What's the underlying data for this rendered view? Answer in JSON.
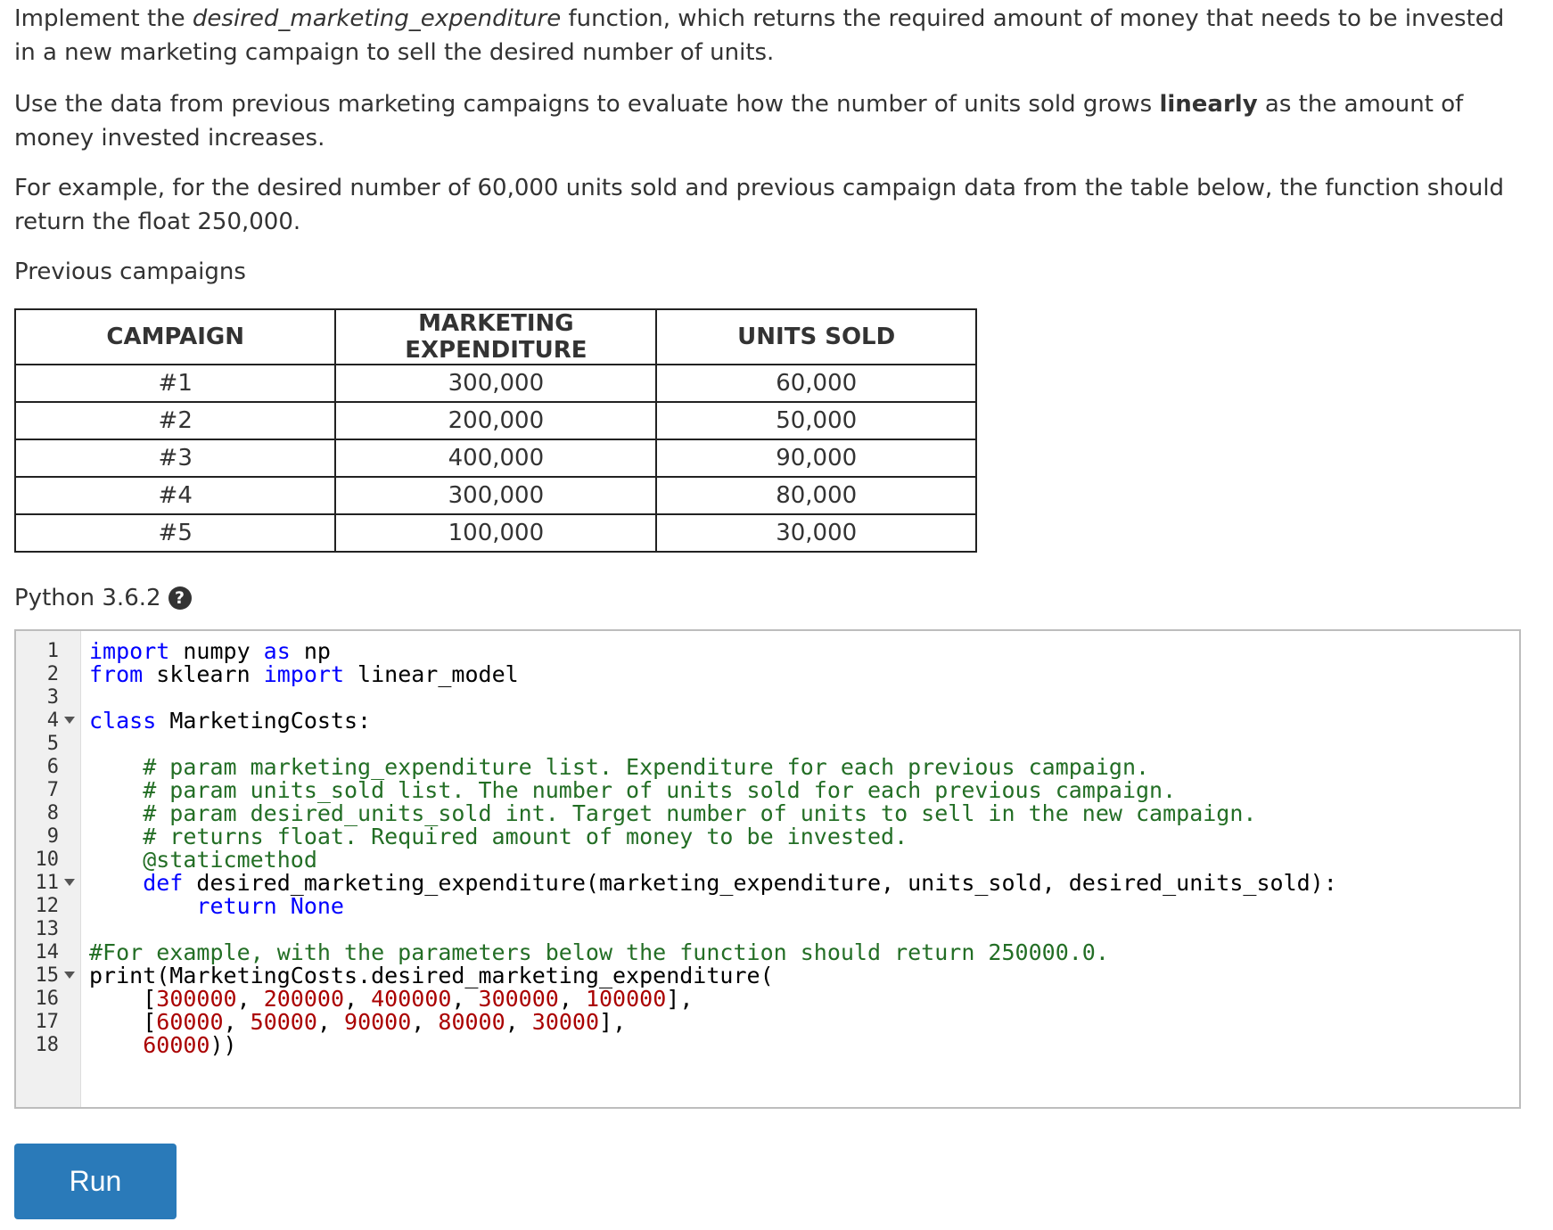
{
  "description": {
    "p1": {
      "before": "Implement the ",
      "func_name": "desired_marketing_expenditure",
      "after": " function, which returns the required amount of money that needs to be invested in a new marketing campaign to sell the desired number of units."
    },
    "p2": {
      "before": "Use the data from previous marketing campaigns to evaluate how the number of units sold grows ",
      "bold": "linearly",
      "after": " as the amount of money invested increases."
    },
    "p3": "For example, for the desired number of 60,000 units sold and previous campaign data from the table below, the function should return the float 250,000.",
    "p4": "Previous campaigns"
  },
  "table": {
    "headers": [
      "CAMPAIGN",
      "MARKETING EXPENDITURE",
      "UNITS SOLD"
    ],
    "rows": [
      [
        "#1",
        "300,000",
        "60,000"
      ],
      [
        "#2",
        "200,000",
        "50,000"
      ],
      [
        "#3",
        "400,000",
        "90,000"
      ],
      [
        "#4",
        "300,000",
        "80,000"
      ],
      [
        "#5",
        "100,000",
        "30,000"
      ]
    ]
  },
  "editor": {
    "language_label": "Python 3.6.2",
    "help_icon": "question-circle-icon",
    "line_numbers": [
      "1",
      "2",
      "3",
      "4",
      "5",
      "6",
      "7",
      "8",
      "9",
      "10",
      "11",
      "12",
      "13",
      "14",
      "15",
      "16",
      "17",
      "18"
    ],
    "fold_lines": [
      "4",
      "11",
      "15"
    ],
    "code": {
      "l1_kw1": "import",
      "l1_mid": " numpy ",
      "l1_kw2": "as",
      "l1_end": " np",
      "l2_kw1": "from",
      "l2_mid": " sklearn ",
      "l2_kw2": "import",
      "l2_end": " linear_model",
      "l4_kw": "class",
      "l4_end": " MarketingCosts:",
      "l6": "    # param marketing_expenditure list. Expenditure for each previous campaign.",
      "l7": "    # param units_sold list. The number of units sold for each previous campaign.",
      "l8": "    # param desired_units_sold int. Target number of units to sell in the new campaign.",
      "l9": "    # returns float. Required amount of money to be invested.",
      "l10": "    @staticmethod",
      "l11_kw": "    def",
      "l11_end": " desired_marketing_expenditure(marketing_expenditure, units_sold, desired_units_sold):",
      "l12_kw1": "        return",
      "l12_kw2": " None",
      "l14": "#For example, with the parameters below the function should return 250000.0.",
      "l15": "print(MarketingCosts.desired_marketing_expenditure(",
      "l16_open": "    [",
      "l16_n1": "300000",
      "l16_n2": "200000",
      "l16_n3": "400000",
      "l16_n4": "300000",
      "l16_n5": "100000",
      "l16_close": "],",
      "l17_open": "    [",
      "l17_n1": "60000",
      "l17_n2": "50000",
      "l17_n3": "90000",
      "l17_n4": "80000",
      "l17_n5": "30000",
      "l17_close": "],",
      "l18_pad": "    ",
      "l18_n": "60000",
      "l18_close": "))",
      "sep": ", "
    }
  },
  "run_button": {
    "label": "Run",
    "color": "#2a7ab9"
  }
}
